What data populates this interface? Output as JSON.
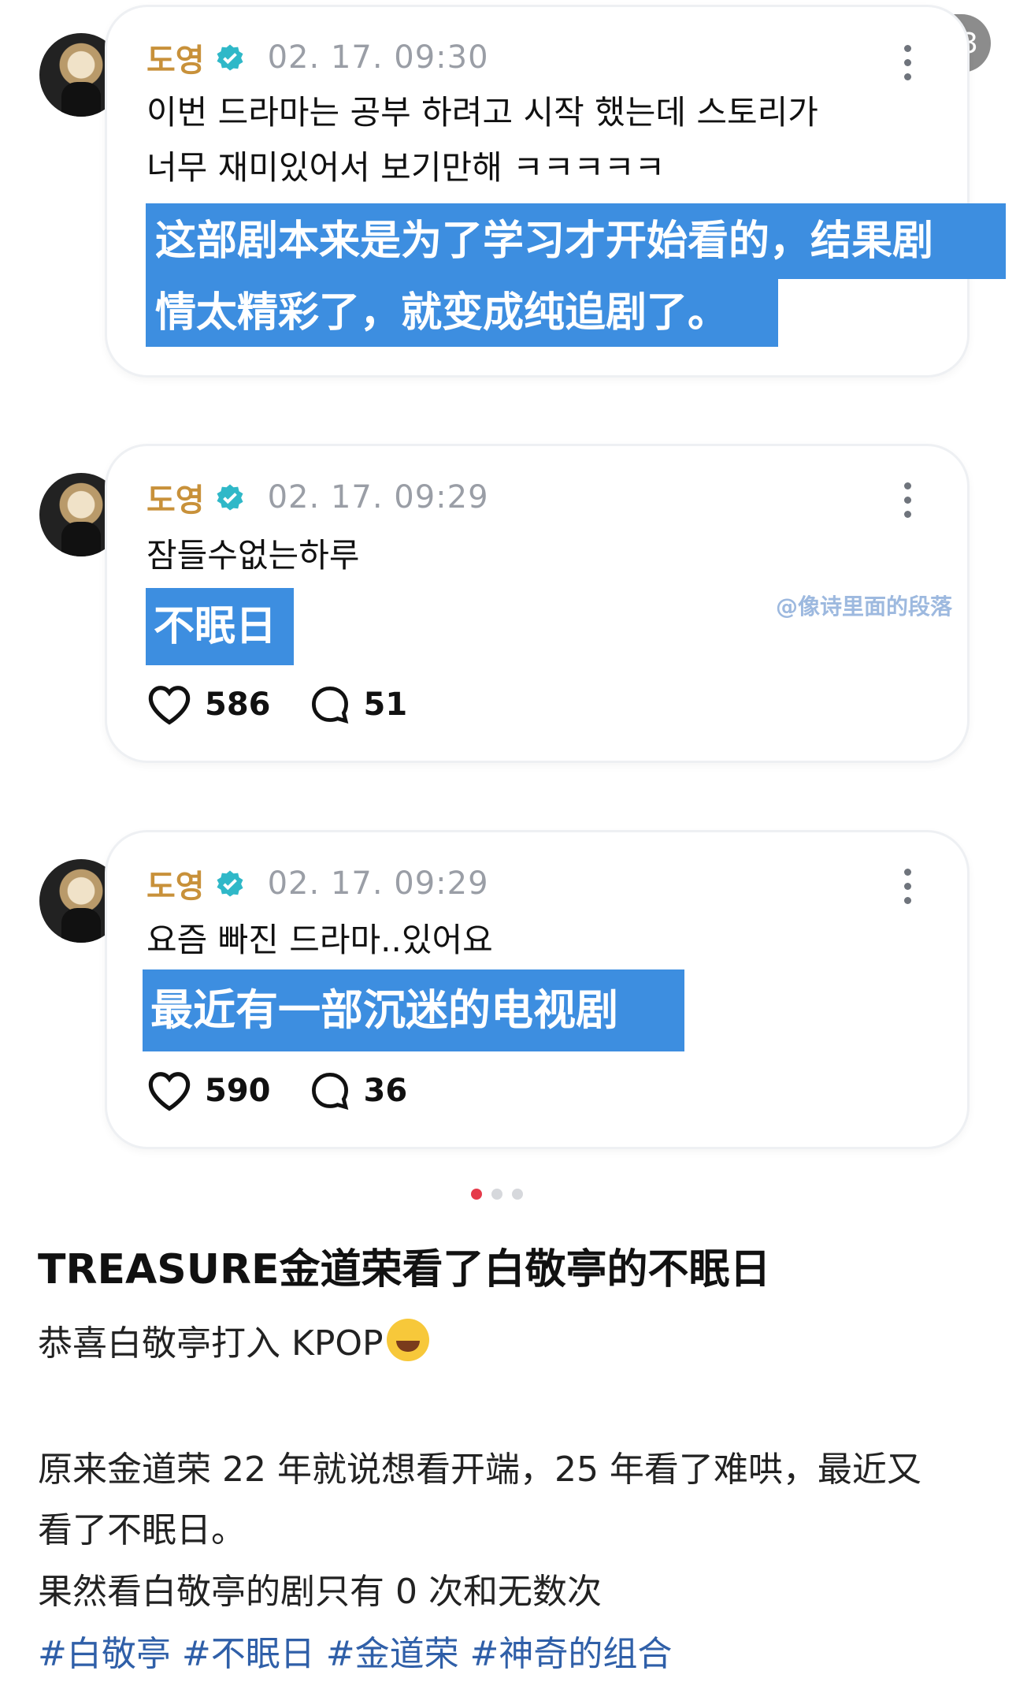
{
  "pager": "1/3",
  "watermark": "@像诗里面的段落",
  "posts": [
    {
      "name": "도영",
      "time": "02. 17. 09:30",
      "text_lines": [
        "이번 드라마는 공부 하려고 시작 했는데 스토리가",
        "너무 재미있어서 보기만해 ㅋㅋㅋㅋㅋ"
      ],
      "translation_lines": [
        "这部剧本来是为了学习才开始看的，结果剧",
        "情太精彩了，就变成纯追剧了。"
      ]
    },
    {
      "name": "도영",
      "time": "02. 17. 09:29",
      "text_lines": [
        "잠들수없는하루"
      ],
      "translation_lines": [
        "不眠日"
      ],
      "likes": "586",
      "comments": "51"
    },
    {
      "name": "도영",
      "time": "02. 17. 09:29",
      "text_lines": [
        "요즘 빠진 드라마..있어요"
      ],
      "translation_lines": [
        "最近有一部沉迷的电视剧"
      ],
      "likes": "590",
      "comments": "36"
    }
  ],
  "carousel": {
    "count": 3,
    "active": 1
  },
  "post_title": "TREASURE金道荣看了白敬亭的不眠日",
  "body": {
    "line1": "恭喜白敬亭打入 KPOP",
    "line2": "原来金道荣 22 年就说想看开端，25 年看了难哄，最近又",
    "line3": "看了不眠日。",
    "line4": "果然看白敬亭的剧只有 0 次和无数次",
    "tags": "#白敬亭 #不眠日 #金道荣 #神奇的组合"
  },
  "colors": {
    "accent_highlight": "#3d8ee0",
    "name": "#c8913a",
    "verified": "#2fb8c8",
    "tag": "#2f5fa8"
  }
}
